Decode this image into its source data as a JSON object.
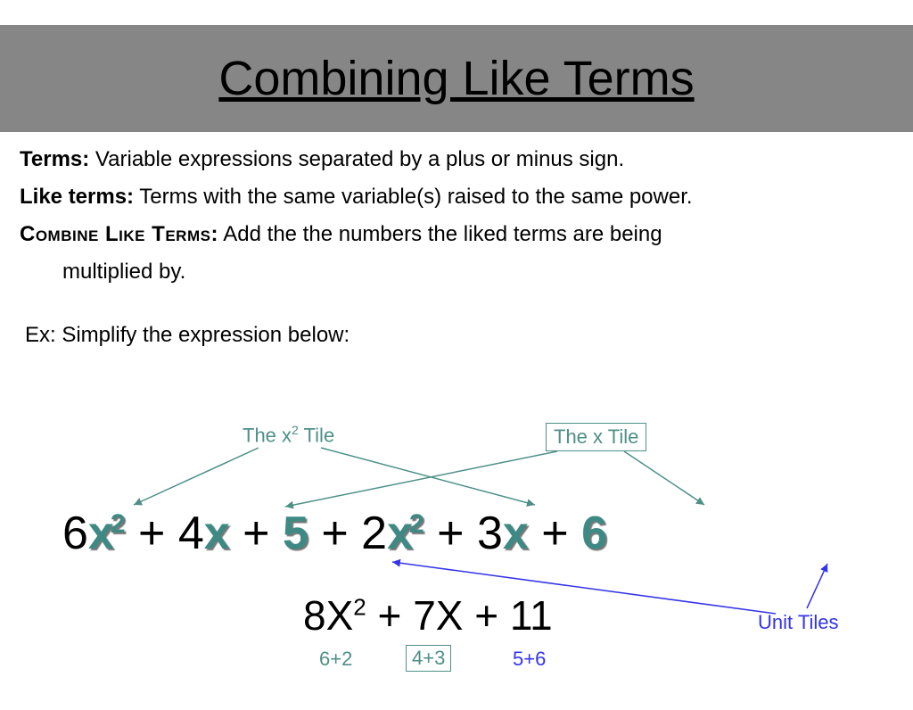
{
  "title": "Combining Like Terms",
  "defs": {
    "terms_label": "Terms:",
    "terms_text": " Variable expressions separated by a plus or minus sign.",
    "like_label": "Like terms:",
    "like_text": " Terms with the same variable(s) raised to the same power.",
    "combine_label": "Combine Like Terms:",
    "combine_text_a": " Add the the numbers the liked terms are being",
    "combine_text_b": "multiplied by."
  },
  "example_prompt": "Ex: Simplify the expression below:",
  "annot": {
    "x2tile": "The x",
    "x2tile_sup": "2",
    "x2tile_after": " Tile",
    "xtile": "The x Tile",
    "unit": "Unit Tiles"
  },
  "expr": {
    "c1": "6",
    "v1": "x",
    "e1": "2",
    "c2": "4",
    "v2": "x",
    "k1": "5",
    "c3": "2",
    "v3": "x",
    "e3": "2",
    "c4": "3",
    "v4": "x",
    "k2": "6",
    "plus": " + "
  },
  "result": {
    "a": "8",
    "xa": "X",
    "ea": "2",
    "b": "7",
    "xb": "X",
    "c": "11",
    "plus": " + "
  },
  "sums": {
    "s1": "6+2",
    "s2": "4+3",
    "s3": "5+6"
  }
}
